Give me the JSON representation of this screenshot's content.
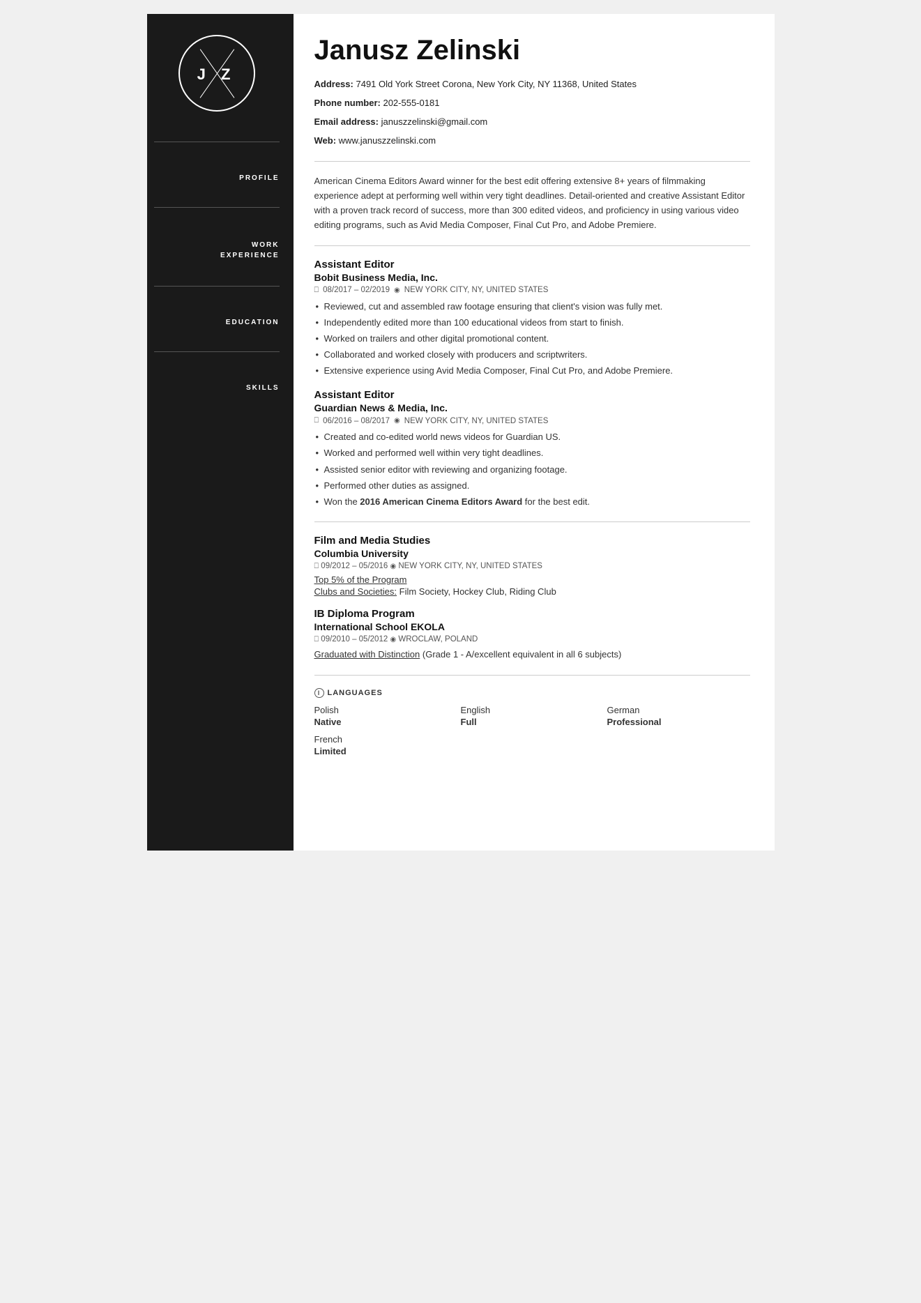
{
  "header": {
    "name": "Janusz Zelinski",
    "address_label": "Address:",
    "address_value": "7491 Old York Street Corona, New York City, NY 11368, United States",
    "phone_label": "Phone number:",
    "phone_value": "202-555-0181",
    "email_label": "Email address:",
    "email_value": "januszzelinski@gmail.com",
    "web_label": "Web:",
    "web_value": "www.januszzelinski.com",
    "initials": "J    Z"
  },
  "profile": {
    "section_label": "PROFILE",
    "text": "American Cinema Editors Award winner for the best edit offering extensive 8+ years of filmmaking experience adept at performing well within very tight deadlines. Detail-oriented and creative Assistant Editor with a proven track record of success, more than 300 edited videos, and proficiency in using various video editing programs, such as Avid Media Composer, Final Cut Pro, and Adobe Premiere."
  },
  "work_experience": {
    "section_label": "WORK EXPERIENCE",
    "jobs": [
      {
        "title": "Assistant Editor",
        "company": "Bobit Business Media, Inc.",
        "dates": "08/2017 – 02/2019",
        "location": "NEW YORK CITY, NY, UNITED STATES",
        "bullets": [
          "Reviewed, cut and assembled raw footage ensuring that client's vision was fully met.",
          "Independently edited more than 100 educational videos from start to finish.",
          "Worked on trailers and other digital promotional content.",
          "Collaborated and worked closely with producers and scriptwriters.",
          "Extensive experience using Avid Media Composer, Final Cut Pro, and Adobe Premiere."
        ]
      },
      {
        "title": "Assistant Editor",
        "company": "Guardian News & Media, Inc.",
        "dates": "06/2016 – 08/2017",
        "location": "NEW YORK CITY, NY, UNITED STATES",
        "bullets": [
          "Created and co-edited world news videos for Guardian US.",
          "Worked and performed well within very tight deadlines.",
          "Assisted senior editor with reviewing and organizing footage.",
          "Performed other duties as assigned.",
          "Won the 2016 American Cinema Editors Award for the best edit."
        ]
      }
    ]
  },
  "education": {
    "section_label": "EDUCATION",
    "schools": [
      {
        "degree": "Film and Media Studies",
        "school": "Columbia University",
        "dates": "09/2012 – 05/2016",
        "location": "NEW YORK CITY, NY, UNITED STATES",
        "detail": "Top 5% of the Program",
        "clubs_label": "Clubs and Societies:",
        "clubs_value": "Film Society, Hockey Club, Riding Club"
      },
      {
        "degree": "IB Diploma Program",
        "school": "International School EKOLA",
        "dates": "09/2010 – 05/2012",
        "location": "WROCLAW, POLAND",
        "detail": "Graduated with Distinction",
        "extra": "(Grade 1 - A/excellent equivalent in all 6 subjects)"
      }
    ]
  },
  "skills": {
    "section_label": "SKILLS",
    "languages_label": "LANGUAGES",
    "languages": [
      {
        "name": "Polish",
        "level": "Native"
      },
      {
        "name": "English",
        "level": "Full"
      },
      {
        "name": "German",
        "level": "Professional"
      },
      {
        "name": "French",
        "level": "Limited"
      }
    ]
  },
  "icons": {
    "calendar": "🖿",
    "location": "◌",
    "info": "i"
  }
}
